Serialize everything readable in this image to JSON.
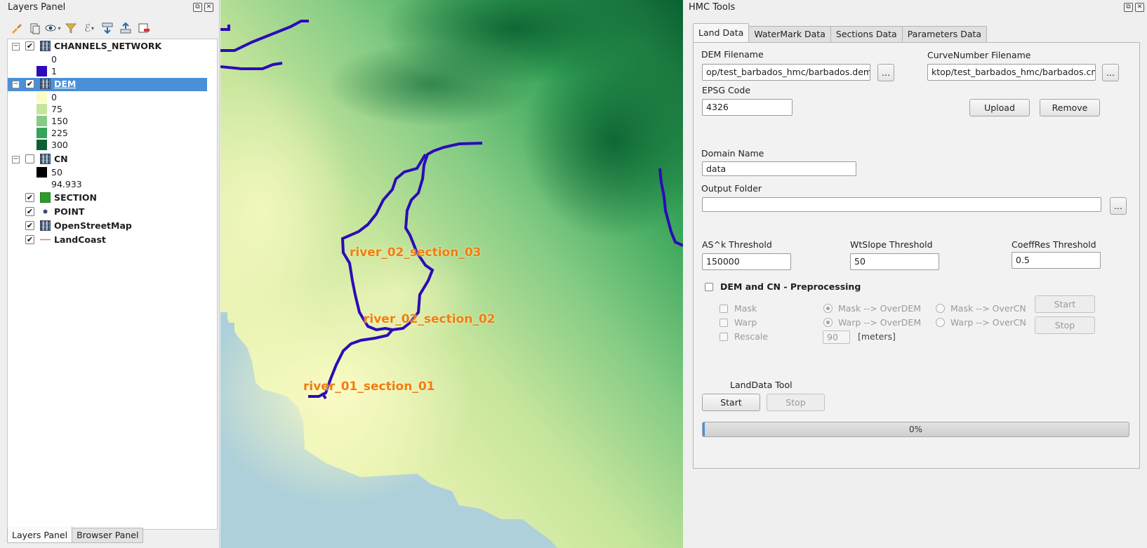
{
  "layers_panel": {
    "title": "Layers Panel",
    "layers": [
      {
        "name": "CHANNELS_NETWORK",
        "checked": true,
        "expanded": true,
        "icon": "raster-icon",
        "legend": [
          {
            "label": "0",
            "color": ""
          },
          {
            "label": "1",
            "color": "#2c0bb8"
          }
        ]
      },
      {
        "name": "DEM",
        "checked": true,
        "expanded": true,
        "selected": true,
        "icon": "raster-icon",
        "legend": [
          {
            "label": "0",
            "color": "#fbfbc4"
          },
          {
            "label": "75",
            "color": "#c6e59c"
          },
          {
            "label": "150",
            "color": "#86cc85"
          },
          {
            "label": "225",
            "color": "#35a358"
          },
          {
            "label": "300",
            "color": "#0b6131"
          }
        ]
      },
      {
        "name": "CN",
        "checked": false,
        "expanded": true,
        "icon": "raster-icon",
        "legend": [
          {
            "label": "50",
            "color": "#000000"
          },
          {
            "label": "94.933",
            "color": ""
          }
        ]
      },
      {
        "name": "SECTION",
        "checked": true,
        "icon": "square-point-icon",
        "color": "#2a9d2a"
      },
      {
        "name": "POINT",
        "checked": true,
        "icon": "circle-point-icon",
        "color": "#3a4a7a"
      },
      {
        "name": "OpenStreetMap",
        "checked": true,
        "icon": "raster-icon"
      },
      {
        "name": "LandCoast",
        "checked": true,
        "icon": "line-icon",
        "color": "#d88080"
      }
    ],
    "bottom_tabs": [
      "Layers Panel",
      "Browser Panel"
    ]
  },
  "map": {
    "labels": [
      "river_02_section_03",
      "river_02_section_02",
      "river_01_section_01"
    ],
    "colors": {
      "river": "#2c0bb8",
      "label": "#f07d12",
      "sea": "#aed0da"
    }
  },
  "hmc": {
    "title": "HMC Tools",
    "tabs": [
      "Land Data",
      "WaterMark Data",
      "Sections Data",
      "Parameters Data"
    ],
    "land_data": {
      "dem_filename_label": "DEM Filename",
      "dem_filename_value": "op/test_barbados_hmc/barbados.dem.txt",
      "curvenumber_label": "CurveNumber Filename",
      "curvenumber_value": "ktop/test_barbados_hmc/barbados.cn.txt",
      "browse_label": "...",
      "epsg_label": "EPSG Code",
      "epsg_value": "4326",
      "upload_label": "Upload",
      "remove_label": "Remove",
      "domain_label": "Domain Name",
      "domain_value": "data",
      "output_label": "Output Folder",
      "output_value": "",
      "ask_label": "AS^k Threshold",
      "ask_value": "150000",
      "wtslope_label": "WtSlope Threshold",
      "wtslope_value": "50",
      "coeffres_label": "CoeffRes Threshold",
      "coeffres_value": "0.5",
      "preprocessing_label": "DEM and CN - Preprocessing",
      "mask_label": "Mask",
      "warp_label": "Warp",
      "rescale_label": "Rescale",
      "mask_overdem": "Mask --> OverDEM",
      "mask_overcn": "Mask --> OverCN",
      "warp_overdem": "Warp --> OverDEM",
      "warp_overcn": "Warp --> OverCN",
      "rescale_value": "90",
      "rescale_unit": "[meters]",
      "pre_start": "Start",
      "pre_stop": "Stop",
      "tool_label": "LandData Tool",
      "tool_start": "Start",
      "tool_stop": "Stop",
      "progress_text": "0%",
      "progress_value": 0
    }
  }
}
